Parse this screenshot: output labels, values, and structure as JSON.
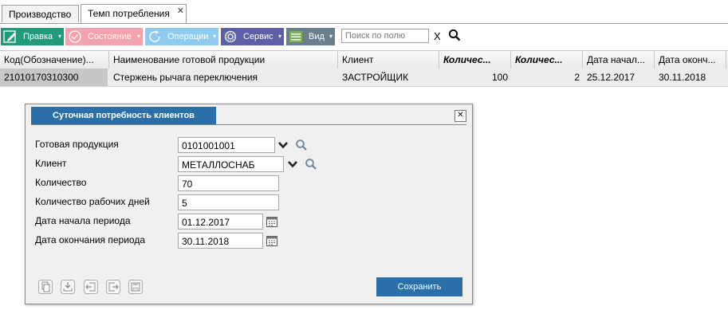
{
  "tabs": [
    {
      "label": "Производство"
    },
    {
      "label": "Темп потребления",
      "close": "✕"
    }
  ],
  "toolbar": {
    "edit_label": "Правка",
    "state_label": "Состояние",
    "operations_label": "Операции",
    "service_label": "Сервис",
    "view_label": "Вид",
    "dropdown_glyph": "▾",
    "search_placeholder": "Поиск по полю",
    "clear_label": "X",
    "colors": {
      "edit": "#1f9a7a",
      "state": "#f2a3ad",
      "operations": "#8fcbee",
      "service": "#5b5fa8",
      "view": "#6a7f8e"
    }
  },
  "grid": {
    "columns": [
      "Код(Обозначение)...",
      "Наименование готовой продукции",
      "Клиент",
      "Количес...",
      "Количес...",
      "Дата начал...",
      "Дата оконч..."
    ],
    "rows": [
      [
        "21010170310300",
        "Стержень рычага переключения",
        "ЗАСТРОЙЩИК",
        "100",
        "2",
        "25.12.2017",
        "30.11.2018"
      ]
    ]
  },
  "dialog": {
    "title": "Суточная потребность клиентов",
    "close": "✕",
    "fields": [
      {
        "label": "Готовая продукция",
        "value": "0101001001"
      },
      {
        "label": "Клиент",
        "value": "МЕТАЛЛОСНАБ"
      },
      {
        "label": "Количество",
        "value": "70"
      },
      {
        "label": "Количество рабочих дней",
        "value": "5"
      },
      {
        "label": "Дата начала периода",
        "value": "01.12.2017"
      },
      {
        "label": "Дата окончания периода",
        "value": "30.11.2018"
      }
    ],
    "save_label": "Сохранить",
    "accent": "#2a6fa8"
  }
}
